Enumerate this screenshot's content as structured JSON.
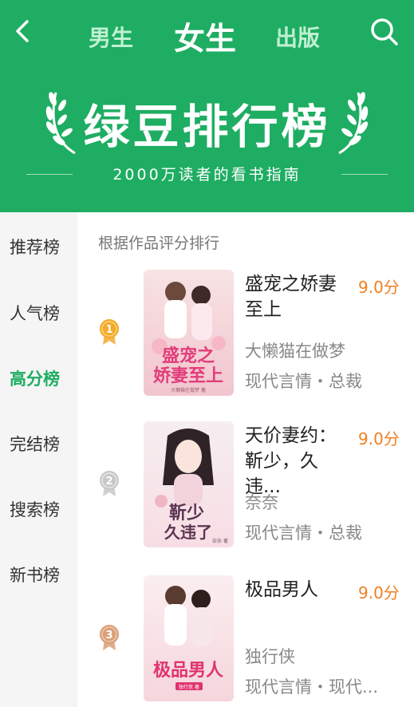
{
  "header": {
    "tabs": [
      "男生",
      "女生",
      "出版"
    ],
    "banner_title": "绿豆排行榜",
    "banner_subtitle": "2000万读者的看书指南",
    "accent_color": "#1ead62"
  },
  "sidebar": {
    "items": [
      "推荐榜",
      "人气榜",
      "高分榜",
      "完结榜",
      "搜索榜",
      "新书榜"
    ],
    "active_index": 2
  },
  "main": {
    "caption": "根据作品评分排行",
    "books": [
      {
        "rank": "1",
        "title": "盛宠之娇妻至上",
        "title_display": "盛宠之娇妻\n至上",
        "score": "9.0分",
        "author": "大懒猫在做梦",
        "genre": "现代言情・总裁",
        "cover_text": "盛宠之\n娇妻至上",
        "cover_small": "大懒猫在做梦 著"
      },
      {
        "rank": "2",
        "title": "天价妻约：靳少，久违...",
        "title_display": "天价妻约：\n靳少，久违...",
        "score": "9.0分",
        "author": "奈奈",
        "genre": "现代言情・总裁",
        "cover_text": "靳少\n久违了",
        "cover_small": "奈奈 著"
      },
      {
        "rank": "3",
        "title": "极品男人",
        "title_display": "极品男人",
        "score": "9.0分",
        "author": "独行侠",
        "genre": "现代言情・现代...",
        "cover_text": "极品男人",
        "cover_small": "独行侠 著"
      }
    ]
  },
  "icons": {
    "back": "chevron-left-icon",
    "search": "search-icon",
    "laurel": "laurel-icon",
    "medal": "medal-icon"
  },
  "colors": {
    "gold": "#f3a92b",
    "silver": "#c8c8c8",
    "bronze": "#d9a07a",
    "score": "#f08022"
  }
}
